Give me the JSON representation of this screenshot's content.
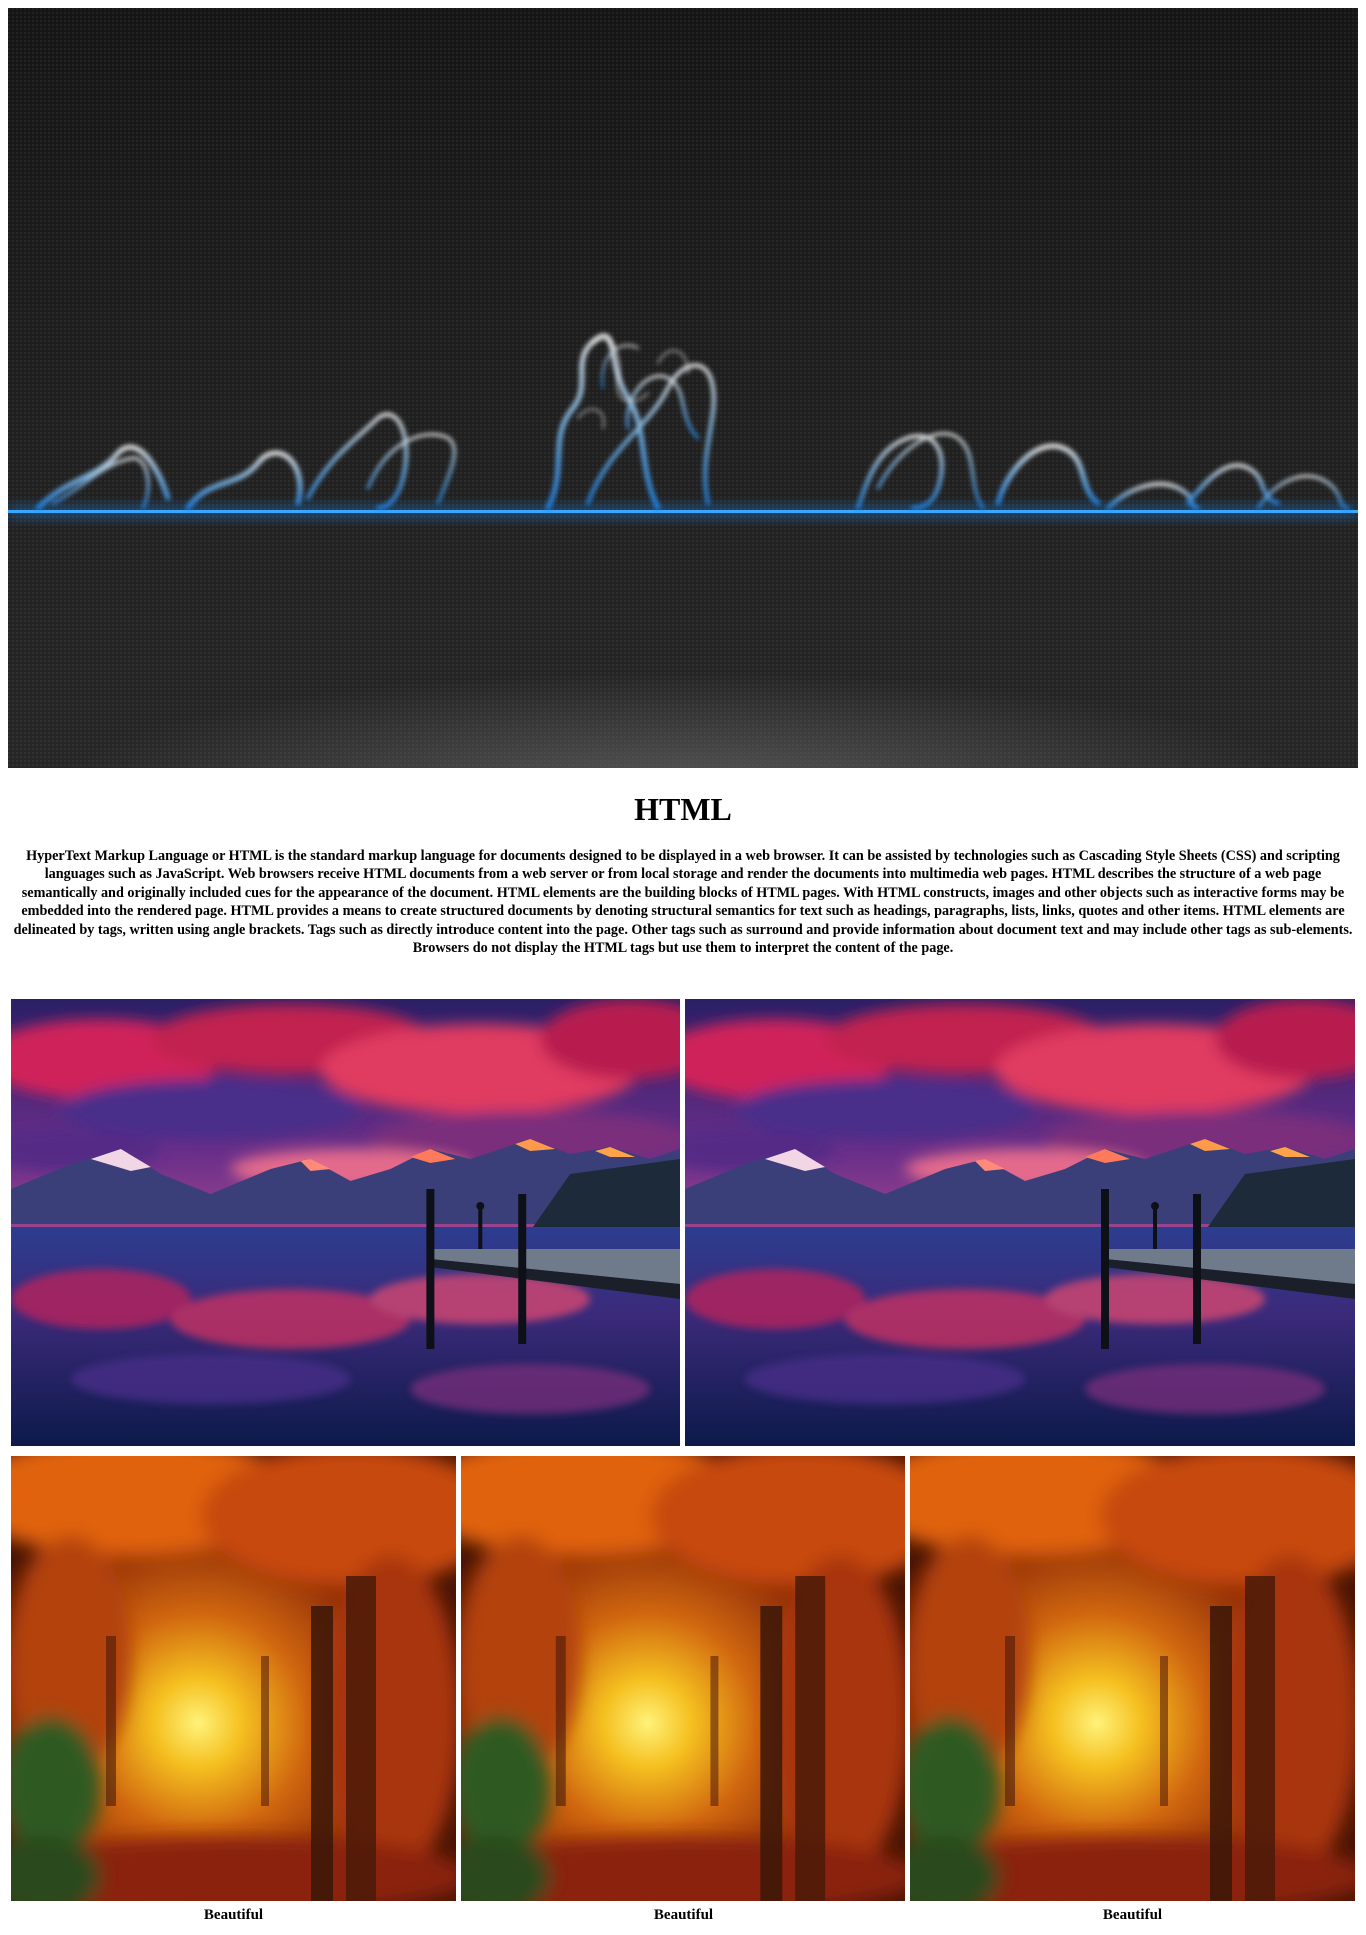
{
  "hero": {
    "image": "blue-smoke-banner"
  },
  "article": {
    "title": "HTML",
    "description": "HyperText Markup Language or HTML is the standard markup language for documents designed to be displayed in a web browser. It can be assisted by technologies such as Cascading Style Sheets (CSS) and scripting languages such as JavaScript. Web browsers receive HTML documents from a web server or from local storage and render the documents into multimedia web pages. HTML describes the structure of a web page semantically and originally included cues for the appearance of the document. HTML elements are the building blocks of HTML pages. With HTML constructs, images and other objects such as interactive forms may be embedded into the rendered page. HTML provides a means to create structured documents by denoting structural semantics for text such as headings, paragraphs, lists, links, quotes and other items. HTML elements are delineated by tags, written using angle brackets. Tags such as directly introduce content into the page. Other tags such as surround and provide information about document text and may include other tags as sub-elements. Browsers do not display the HTML tags but use them to interpret the content of the page."
  },
  "gallery": {
    "row1": [
      {
        "image": "mountain-lake-sunset"
      },
      {
        "image": "mountain-lake-sunset"
      }
    ],
    "row2": [
      {
        "image": "autumn-forest-path",
        "caption": "Beautiful"
      },
      {
        "image": "autumn-forest-path",
        "caption": "Beautiful"
      },
      {
        "image": "autumn-forest-path",
        "caption": "Beautiful"
      }
    ]
  },
  "colors": {
    "accent": "#1e90ff",
    "smoke": "#4fb3ff",
    "background": "#ffffff"
  }
}
